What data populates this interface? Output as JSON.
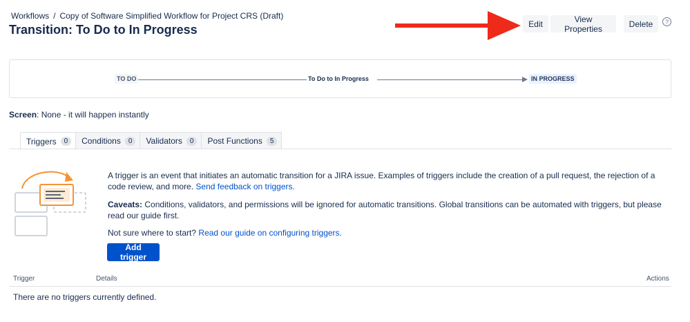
{
  "breadcrumb": {
    "items": [
      "Workflows",
      "Copy of Software Simplified Workflow for Project CRS (Draft)"
    ],
    "separator": "/"
  },
  "page_title": "Transition: To Do to In Progress",
  "header_actions": {
    "edit_label": "Edit",
    "view_properties_label": "View Properties",
    "delete_label": "Delete",
    "help_glyph": "?"
  },
  "annotation_arrow_color": "#ee2a1b",
  "diagram": {
    "from_status": "TO DO",
    "to_status": "IN PROGRESS",
    "transition_label": "To Do to In Progress"
  },
  "screen": {
    "label": "Screen",
    "value": ": None - it will happen instantly"
  },
  "tabs": [
    {
      "label": "Triggers",
      "count": "0"
    },
    {
      "label": "Conditions",
      "count": "0"
    },
    {
      "label": "Validators",
      "count": "0"
    },
    {
      "label": "Post Functions",
      "count": "5"
    }
  ],
  "triggers_info": {
    "intro": "A trigger is an event that initiates an automatic transition for a JIRA issue. Examples of triggers include the creation of a pull request, the rejection of a code review, and more.",
    "feedback_link": "Send feedback on triggers.",
    "caveats_label": "Caveats:",
    "caveats_text": "Conditions, validators, and permissions will be ignored for automatic transitions. Global transitions can be automated with triggers, but please read our guide first.",
    "not_sure_text": "Not sure where to start?",
    "guide_link": "Read our guide on configuring triggers."
  },
  "add_trigger_label": "Add trigger",
  "table": {
    "columns": [
      "Trigger",
      "Details",
      "Actions"
    ],
    "empty_message": "There are no triggers currently defined."
  },
  "colors": {
    "primary": "#0052cc",
    "text": "#172b4d",
    "accent_orange": "#f79232"
  }
}
